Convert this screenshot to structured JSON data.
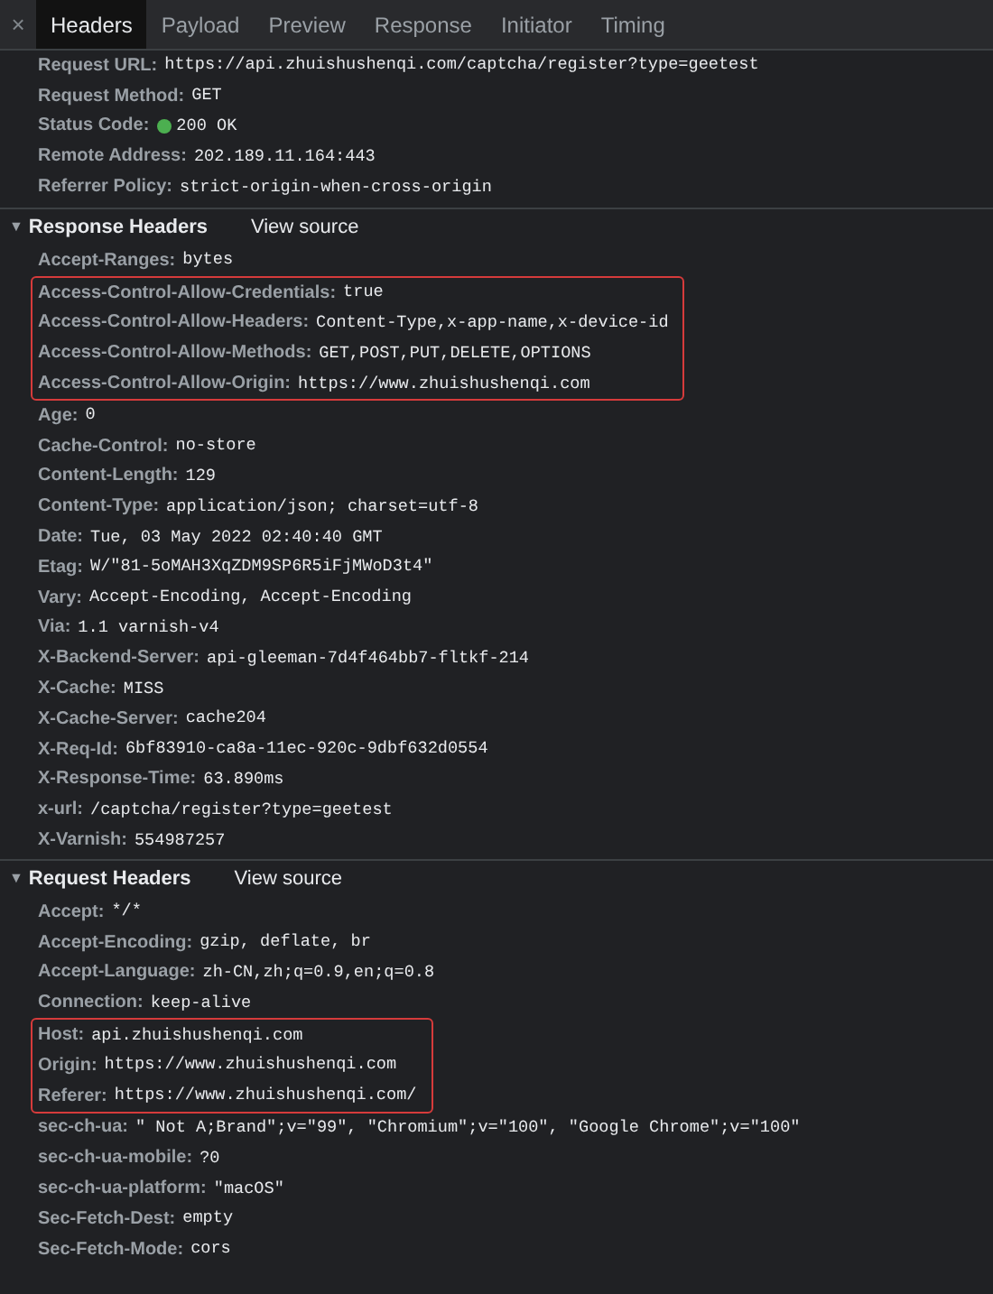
{
  "tabs": [
    {
      "label": "Headers",
      "selected": true
    },
    {
      "label": "Payload",
      "selected": false
    },
    {
      "label": "Preview",
      "selected": false
    },
    {
      "label": "Response",
      "selected": false
    },
    {
      "label": "Initiator",
      "selected": false
    },
    {
      "label": "Timing",
      "selected": false
    }
  ],
  "close": "×",
  "general": [
    {
      "name": "Request URL:",
      "value": "https://api.zhuishushenqi.com/captcha/register?type=geetest",
      "kind": "plain",
      "highlighted": false
    },
    {
      "name": "Request Method:",
      "value": "GET",
      "kind": "plain",
      "highlighted": false
    },
    {
      "name": "Status Code:",
      "value": "200 OK",
      "kind": "status",
      "highlighted": false
    },
    {
      "name": "Remote Address:",
      "value": "202.189.11.164:443",
      "kind": "plain",
      "highlighted": false
    },
    {
      "name": "Referrer Policy:",
      "value": "strict-origin-when-cross-origin",
      "kind": "plain",
      "highlighted": false
    }
  ],
  "sections": [
    {
      "title": "Response Headers",
      "toggle": "▼",
      "expanded": true,
      "link": "View source",
      "rows": [
        {
          "name": "Accept-Ranges:",
          "value": "bytes",
          "kind": "plain",
          "highlighted": false
        },
        {
          "name": "Access-Control-Allow-Credentials:",
          "value": "true",
          "kind": "plain",
          "highlighted": true
        },
        {
          "name": "Access-Control-Allow-Headers:",
          "value": "Content-Type,x-app-name,x-device-id",
          "kind": "plain",
          "highlighted": true
        },
        {
          "name": "Access-Control-Allow-Methods:",
          "value": "GET,POST,PUT,DELETE,OPTIONS",
          "kind": "plain",
          "highlighted": true
        },
        {
          "name": "Access-Control-Allow-Origin:",
          "value": "https://www.zhuishushenqi.com",
          "kind": "plain",
          "highlighted": true
        },
        {
          "name": "Age:",
          "value": "0",
          "kind": "plain",
          "highlighted": false
        },
        {
          "name": "Cache-Control:",
          "value": "no-store",
          "kind": "plain",
          "highlighted": false
        },
        {
          "name": "Content-Length:",
          "value": "129",
          "kind": "plain",
          "highlighted": false
        },
        {
          "name": "Content-Type:",
          "value": "application/json; charset=utf-8",
          "kind": "plain",
          "highlighted": false
        },
        {
          "name": "Date:",
          "value": "Tue, 03 May 2022 02:40:40 GMT",
          "kind": "plain",
          "highlighted": false
        },
        {
          "name": "Etag:",
          "value": "W/\"81-5oMAH3XqZDM9SP6R5iFjMWoD3t4\"",
          "kind": "plain",
          "highlighted": false
        },
        {
          "name": "Vary:",
          "value": "Accept-Encoding, Accept-Encoding",
          "kind": "plain",
          "highlighted": false
        },
        {
          "name": "Via:",
          "value": "1.1 varnish-v4",
          "kind": "plain",
          "highlighted": false
        },
        {
          "name": "X-Backend-Server:",
          "value": "api-gleeman-7d4f464bb7-fltkf-214",
          "kind": "plain",
          "highlighted": false
        },
        {
          "name": "X-Cache:",
          "value": "MISS",
          "kind": "plain",
          "highlighted": false
        },
        {
          "name": "X-Cache-Server:",
          "value": "cache204",
          "kind": "plain",
          "highlighted": false
        },
        {
          "name": "X-Req-Id:",
          "value": "6bf83910-ca8a-11ec-920c-9dbf632d0554",
          "kind": "plain",
          "highlighted": false
        },
        {
          "name": "X-Response-Time:",
          "value": "63.890ms",
          "kind": "plain",
          "highlighted": false
        },
        {
          "name": "x-url:",
          "value": "/captcha/register?type=geetest",
          "kind": "plain",
          "highlighted": false
        },
        {
          "name": "X-Varnish:",
          "value": "554987257",
          "kind": "plain",
          "highlighted": false
        }
      ]
    },
    {
      "title": "Request Headers",
      "toggle": "▼",
      "expanded": true,
      "link": "View source",
      "rows": [
        {
          "name": "Accept:",
          "value": "*/*",
          "kind": "plain",
          "highlighted": false
        },
        {
          "name": "Accept-Encoding:",
          "value": "gzip, deflate, br",
          "kind": "plain",
          "highlighted": false
        },
        {
          "name": "Accept-Language:",
          "value": "zh-CN,zh;q=0.9,en;q=0.8",
          "kind": "plain",
          "highlighted": false
        },
        {
          "name": "Connection:",
          "value": "keep-alive",
          "kind": "plain",
          "highlighted": false
        },
        {
          "name": "Host:",
          "value": "api.zhuishushenqi.com",
          "kind": "plain",
          "highlighted": true
        },
        {
          "name": "Origin:",
          "value": "https://www.zhuishushenqi.com",
          "kind": "plain",
          "highlighted": true
        },
        {
          "name": "Referer:",
          "value": "https://www.zhuishushenqi.com/",
          "kind": "plain",
          "highlighted": true
        },
        {
          "name": "sec-ch-ua:",
          "value": "\" Not A;Brand\";v=\"99\", \"Chromium\";v=\"100\", \"Google Chrome\";v=\"100\"",
          "kind": "plain",
          "highlighted": false
        },
        {
          "name": "sec-ch-ua-mobile:",
          "value": "?0",
          "kind": "plain",
          "highlighted": false
        },
        {
          "name": "sec-ch-ua-platform:",
          "value": "\"macOS\"",
          "kind": "plain",
          "highlighted": false
        },
        {
          "name": "Sec-Fetch-Dest:",
          "value": "empty",
          "kind": "plain",
          "highlighted": false
        },
        {
          "name": "Sec-Fetch-Mode:",
          "value": "cors",
          "kind": "plain",
          "highlighted": false
        }
      ]
    }
  ]
}
